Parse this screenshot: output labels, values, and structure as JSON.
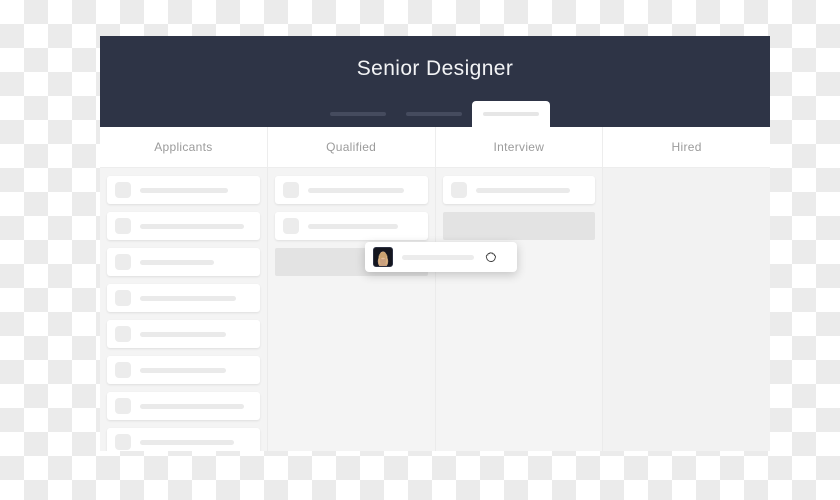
{
  "window": {
    "header": {
      "title": "Senior Designer",
      "background_color": "#2e3446",
      "title_color": "#f2f3f5"
    },
    "tabs": [
      {
        "name": "tab-1",
        "label": "",
        "active": false,
        "bar_color": "#454b5e"
      },
      {
        "name": "tab-2",
        "label": "",
        "active": false,
        "bar_color": "#454b5e"
      },
      {
        "name": "tab-3",
        "label": "",
        "active": true,
        "bar_color": "#e6e6e6"
      }
    ],
    "columns": [
      {
        "id": "applicants",
        "header": "Applicants",
        "cards": [
          {
            "line_width": 88
          },
          {
            "line_width": 104
          },
          {
            "line_width": 74
          },
          {
            "line_width": 96
          },
          {
            "line_width": 86
          },
          {
            "line_width": 86
          },
          {
            "line_width": 104
          },
          {
            "line_width": 94
          }
        ],
        "placeholder": null
      },
      {
        "id": "qualified",
        "header": "Qualified",
        "cards": [
          {
            "line_width": 96
          },
          {
            "line_width": 90
          }
        ],
        "placeholder": {
          "position": 2
        }
      },
      {
        "id": "interview",
        "header": "Interview",
        "cards": [
          {
            "line_width": 94
          }
        ],
        "placeholder": {
          "position": 1
        }
      },
      {
        "id": "hired",
        "header": "Hired",
        "cards": [],
        "placeholder": null
      }
    ],
    "dragged_card": {
      "avatar": "person-photo-avatar",
      "line_width": 72,
      "cursor": "grabbing-hand-cursor"
    }
  },
  "colors": {
    "board_background": "#f4f4f4",
    "card_background": "#ffffff",
    "placeholder_gray": "#e3e3e3",
    "divider": "#ebebeb",
    "header_text": "#9b9b9b"
  }
}
